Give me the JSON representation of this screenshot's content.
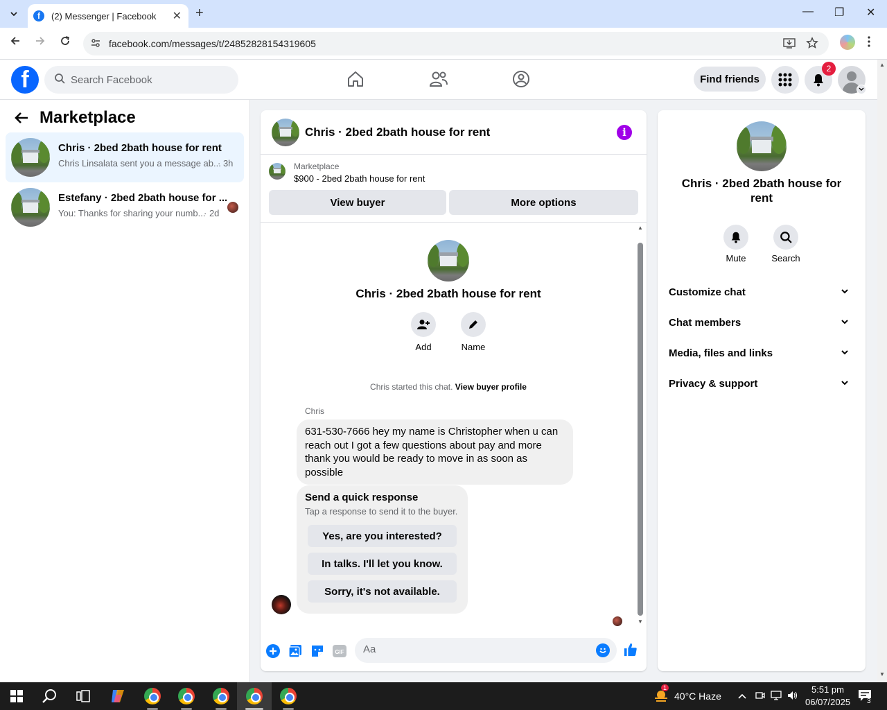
{
  "browser": {
    "tab_title": "(2) Messenger | Facebook",
    "tab_favicon": "f",
    "url": "facebook.com/messages/t/24852828154319605",
    "new_tab": "+",
    "minimize": "—",
    "restore": "❐",
    "close": "✕"
  },
  "fb_header": {
    "logo_letter": "f",
    "search_placeholder": "Search Facebook",
    "find_friends": "Find friends",
    "notification_count": "2"
  },
  "left_panel": {
    "title": "Marketplace",
    "conversations": [
      {
        "name": "Chris · 2bed 2bath house for rent",
        "snippet": "Chris Linsalata sent you a message ab...",
        "time": "· 3h",
        "active": true
      },
      {
        "name": "Estefany · 2bed 2bath house for ...",
        "snippet": "You: Thanks for sharing your numb...",
        "time": "· 2d",
        "active": false
      }
    ]
  },
  "chat": {
    "title": "Chris · 2bed 2bath house for rent",
    "marketplace_label": "Marketplace",
    "listing": "$900 - 2bed 2bath house for rent",
    "view_buyer": "View buyer",
    "more_options": "More options",
    "profile_name": "Chris · 2bed 2bath house for rent",
    "add_label": "Add",
    "name_label": "Name",
    "started_text": "Chris started this chat.",
    "view_buyer_profile": "View buyer profile",
    "sender": "Chris",
    "message": "631-530-7666 hey my name is Christopher when u can reach out I got a few questions about pay and more thank you would be ready to move in as soon as possible",
    "quick_response": {
      "heading": "Send a quick response",
      "subtitle": "Tap a response to send it to the buyer.",
      "options": [
        "Yes, are you interested?",
        "In talks. I'll let you know.",
        "Sorry, it's not available."
      ]
    },
    "composer_placeholder": "Aa",
    "gif_label": "GIF"
  },
  "right_panel": {
    "name": "Chris · 2bed 2bath house for rent",
    "mute": "Mute",
    "search": "Search",
    "sections": [
      "Customize chat",
      "Chat members",
      "Media, files and links",
      "Privacy & support"
    ]
  },
  "taskbar": {
    "weather": "40°C  Haze",
    "weather_badge": "1",
    "time": "5:51 pm",
    "date": "06/07/2025",
    "notif_count": "3"
  },
  "colors": {
    "fb_blue": "#0866ff",
    "accent_purple": "#a000e8",
    "messenger_blue": "#0a7cff",
    "badge_red": "#e41e3f"
  }
}
